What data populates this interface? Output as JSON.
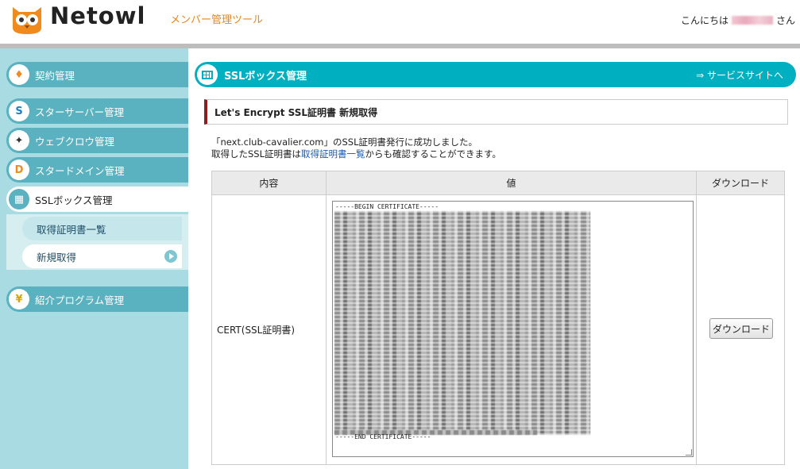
{
  "header": {
    "logo_text": "Netowl",
    "subtitle": "メンバー管理ツール",
    "greeting_prefix": "こんにちは",
    "greeting_suffix": "さん"
  },
  "sidebar": {
    "items": [
      {
        "label": "契約管理"
      },
      {
        "label": "スターサーバー管理"
      },
      {
        "label": "ウェブクロウ管理"
      },
      {
        "label": "スタードメイン管理"
      },
      {
        "label": "SSLボックス管理"
      },
      {
        "label": "紹介プログラム管理"
      }
    ],
    "subitems": [
      {
        "label": "取得証明書一覧"
      },
      {
        "label": "新規取得"
      }
    ]
  },
  "main": {
    "bar_title": "SSLボックス管理",
    "service_link": "⇒ サービスサイトへ",
    "section_title": "Let's Encrypt SSL証明書 新規取得",
    "message_line1": "「next.club-cavalier.com」のSSL証明書発行に成功しました。",
    "message_line2_prefix": "取得したSSL証明書は",
    "message_line2_link": "取得証明書一覧",
    "message_line2_suffix": "からも確認することができます。",
    "table": {
      "headers": [
        "内容",
        "値",
        "ダウンロード"
      ],
      "rows": [
        {
          "label": "CERT(SSL証明書)",
          "begin": "-----BEGIN CERTIFICATE-----",
          "end": "-----END CERTIFICATE-----",
          "button": "ダウンロード"
        }
      ]
    }
  },
  "colors": {
    "accent": "#00b0c0",
    "sidebar": "#a9dce2",
    "subtitle": "#e8861c"
  }
}
